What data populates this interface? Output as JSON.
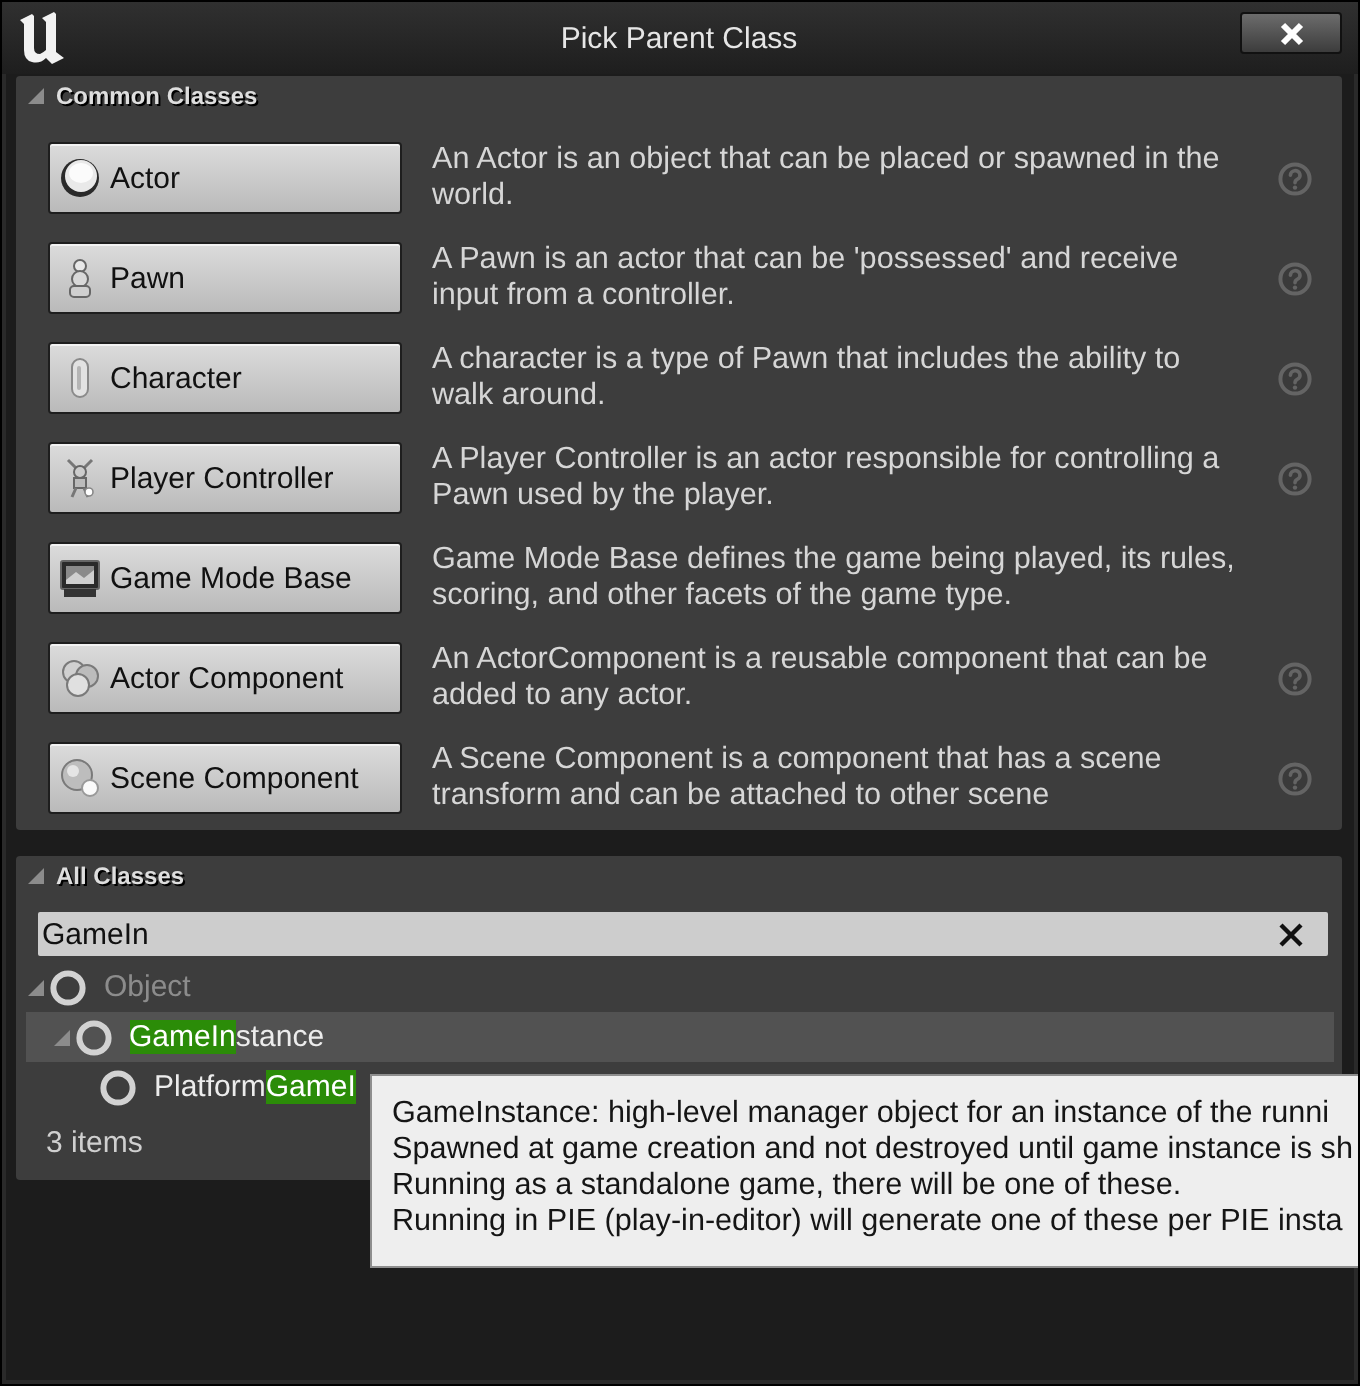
{
  "window": {
    "title": "Pick Parent Class"
  },
  "common_classes": {
    "title": "Common Classes",
    "expanded": true,
    "items": [
      {
        "label": "Actor",
        "description": "An Actor is an object that can be placed or spawned in the world.",
        "help": true
      },
      {
        "label": "Pawn",
        "description": "A Pawn is an actor that can be 'possessed' and receive input from a controller.",
        "help": true
      },
      {
        "label": "Character",
        "description": "A character is a type of Pawn that includes the ability to walk around.",
        "help": true
      },
      {
        "label": "Player Controller",
        "description": "A Player Controller is an actor responsible for controlling a Pawn used by the player.",
        "help": true
      },
      {
        "label": "Game Mode Base",
        "description": "Game Mode Base defines the game being played, its rules, scoring, and other facets of the game type.",
        "help": false
      },
      {
        "label": "Actor Component",
        "description": "An ActorComponent is a reusable component that can be added to any actor.",
        "help": true
      },
      {
        "label": "Scene Component",
        "description": "A Scene Component is a component that has a scene transform and can be attached to other scene",
        "help": true
      }
    ]
  },
  "all_classes": {
    "title": "All Classes",
    "expanded": true,
    "search": {
      "value": "GameIn"
    },
    "tree": [
      {
        "parts": [
          {
            "text": "Object",
            "highlighted": false
          }
        ],
        "dimmed": true,
        "selected": false,
        "expanded": true,
        "children": [
          {
            "parts": [
              {
                "text": "GameIn",
                "highlighted": true
              },
              {
                "text": "stance",
                "highlighted": false
              }
            ],
            "dimmed": false,
            "selected": true,
            "expanded": true,
            "children": [
              {
                "parts": [
                  {
                    "text": "Platform",
                    "highlighted": false
                  },
                  {
                    "text": "GameI",
                    "highlighted": true
                  }
                ],
                "dimmed": false,
                "selected": false
              }
            ]
          }
        ]
      }
    ],
    "item_count": "3 items"
  },
  "tooltip": {
    "lines": [
      "GameInstance: high-level manager object for an instance of the runni",
      "Spawned at game creation and not destroyed until game instance is sh",
      "Running as a standalone game, there will be one of these.",
      "Running in PIE (play-in-editor) will generate one of these per PIE insta"
    ]
  }
}
